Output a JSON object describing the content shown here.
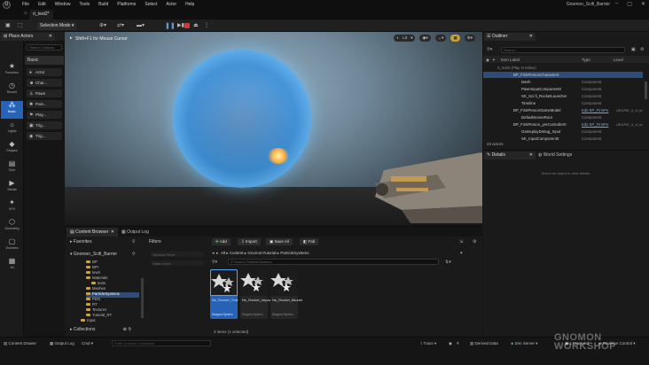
{
  "window": {
    "title": "Gnomon_Scifi_Barrier",
    "level_tab": "rt_test2*"
  },
  "menu": [
    "File",
    "Edit",
    "Window",
    "Tools",
    "Build",
    "Platforms",
    "Select",
    "Actor",
    "Help"
  ],
  "toolbar": {
    "selection_mode": "Selection Mode"
  },
  "viewport": {
    "hint": "Shift+F1 for Mouse Cursor",
    "lit_label": "Lit"
  },
  "place_actors": {
    "tab_label": "Place Actors",
    "search_placeholder": "Search Classes",
    "category": "Basic",
    "items": [
      "Actor",
      "Char...",
      "Pawn",
      "Poin...",
      "Play...",
      "Trig...",
      "Trig..."
    ]
  },
  "left_categories": [
    "Favorites",
    "Recent",
    "Basic",
    "Lights",
    "Shapes",
    "Cine",
    "Media",
    "VFX",
    "Geometry",
    "Volumes",
    "All"
  ],
  "outliner": {
    "tab_label": "Outliner",
    "search_placeholder": "Search...",
    "columns": {
      "label": "Item Label",
      "type": "Type",
      "level": "Level"
    },
    "rows": [
      {
        "name": "rt_test2 (Play In Editor)",
        "type": "",
        "level": "",
        "indent": 16
      },
      {
        "name": "BP_FirstPersonCharacter0",
        "type": "",
        "level": "",
        "indent": 34
      },
      {
        "name": "Mesh",
        "type": "Component",
        "level": "",
        "indent": 43
      },
      {
        "name": "PawnInputComponent0",
        "type": "Component",
        "level": "",
        "indent": 43
      },
      {
        "name": "SK_Sci-fi_RocketLauncher",
        "type": "Component",
        "level": "",
        "indent": 43
      },
      {
        "name": "Timeline",
        "type": "Component",
        "level": "",
        "indent": 43
      },
      {
        "name": "BP_FirstPersonGameModel",
        "type": "Edit BP_FirstPe",
        "level": "UEDPIE_0_rt_te",
        "indent": 34
      },
      {
        "name": "DefaultSceneRoot",
        "type": "Component",
        "level": "",
        "indent": 43
      },
      {
        "name": "BP_FirstPerson_yerController0",
        "type": "Edit BP_FirstPe",
        "level": "UEDPIE_0_rt_te",
        "indent": 34
      },
      {
        "name": "GameplayDebug_Input",
        "type": "Component",
        "level": "",
        "indent": 43
      },
      {
        "name": "SK_InputComponent0",
        "type": "Component",
        "level": "",
        "indent": 43
      }
    ],
    "count": "23 actors"
  },
  "details": {
    "tab_label": "Details",
    "world_settings": "World Settings",
    "message": "Select an object to view details."
  },
  "content_browser": {
    "tab_label": "Content Browser",
    "output_log_tab": "Output Log",
    "favorites": "Favorites",
    "root": "Gnomon_Scifi_Barrier",
    "tree": [
      {
        "name": "BP",
        "indent": 24
      },
      {
        "name": "BPI",
        "indent": 24
      },
      {
        "name": "level",
        "indent": 24
      },
      {
        "name": "Materials",
        "indent": 24
      },
      {
        "name": "tests",
        "indent": 30
      },
      {
        "name": "Meshes",
        "indent": 24
      },
      {
        "name": "ParticleSystems",
        "indent": 24
      },
      {
        "name": "PDG",
        "indent": 24
      },
      {
        "name": "RT",
        "indent": 24
      },
      {
        "name": "Textures",
        "indent": 24
      },
      {
        "name": "Tutorial_RT",
        "indent": 24
      },
      {
        "name": "Input",
        "indent": 18
      }
    ],
    "collections": "Collections",
    "filters_label": "Filters",
    "filters": [
      "Skeletal Mesh",
      "Static Mesh"
    ],
    "buttons": {
      "add": "Add",
      "import": "Import",
      "save_all": "Save All",
      "fab": "Fab"
    },
    "breadcrumb": [
      "All",
      "Content",
      "GnomonTutorial",
      "ParticleSystems"
    ],
    "search_placeholder": "Search ParticleSystems",
    "assets": [
      {
        "name": "Ns_Rocket_Trail",
        "type": "Niagara System",
        "selected": true
      },
      {
        "name": "Ns_Rocket_Impact",
        "type": "Niagara System",
        "selected": false
      },
      {
        "name": "Ns_Rocket_Muzzle",
        "type": "Niagara System",
        "selected": false
      }
    ],
    "selection": "3 items (1 selected)"
  },
  "statusbar": {
    "content_drawer": "Content Drawer",
    "output_log": "Output Log",
    "cmd": "Cmd",
    "cmd_placeholder": "Enter Console Command",
    "trace": "Trace",
    "derived_data": "Derived Data",
    "unsaved": "1 Unsaved",
    "revision_control": "Revision Control",
    "zen": "Zen Server"
  },
  "watermark": {
    "line1": "GNOMON",
    "line2": "WORKSHOP"
  },
  "colors": {
    "accent": "#2662b5",
    "play_green": "#5a9cd8",
    "stop_red": "#c63b3b"
  }
}
